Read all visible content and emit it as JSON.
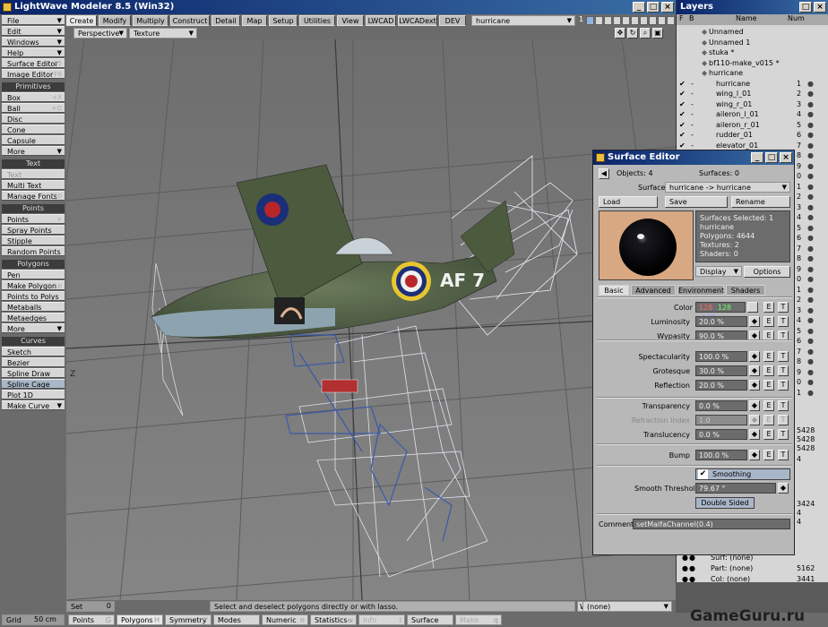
{
  "app": {
    "title": "LightWave Modeler 8.5 (Win32)",
    "min": "_",
    "max": "□",
    "close": "×"
  },
  "left_panel": {
    "top_items": [
      {
        "label": "File",
        "arrow": "▼"
      },
      {
        "label": "Edit",
        "arrow": "▼"
      },
      {
        "label": "Windows",
        "arrow": "▼"
      },
      {
        "label": "Help",
        "arrow": "▼"
      },
      {
        "label": "Surface Editor",
        "shortcut": "F5"
      },
      {
        "label": "Image Editor",
        "shortcut": "F6"
      }
    ],
    "groups": [
      {
        "header": "Primitives",
        "items": [
          {
            "label": "Box",
            "shortcut": "+X"
          },
          {
            "label": "Ball",
            "shortcut": "+O"
          },
          {
            "label": "Disc"
          },
          {
            "label": "Cone"
          },
          {
            "label": "Capsule"
          },
          {
            "label": "More",
            "arrow": "▼"
          }
        ]
      },
      {
        "header": "Text",
        "items": [
          {
            "label": "Text",
            "disabled": true
          },
          {
            "label": "Multi Text"
          },
          {
            "label": "Manage Fonts",
            "shortcut": "F10"
          }
        ]
      },
      {
        "header": "Points",
        "items": [
          {
            "label": "Points",
            "shortcut": "+"
          },
          {
            "label": "Spray Points"
          },
          {
            "label": "Stipple"
          },
          {
            "label": "Random Points"
          }
        ]
      },
      {
        "header": "Polygons",
        "items": [
          {
            "label": "Pen"
          },
          {
            "label": "Make Polygon",
            "shortcut": "p"
          },
          {
            "label": "Points to Polys"
          },
          {
            "label": "Metaballs"
          },
          {
            "label": "Metaedges"
          },
          {
            "label": "More",
            "arrow": "▼"
          }
        ]
      },
      {
        "header": "Curves",
        "items": [
          {
            "label": "Sketch"
          },
          {
            "label": "Bezier"
          },
          {
            "label": "Spline Draw"
          },
          {
            "label": "Spline Cage",
            "selected": true
          },
          {
            "label": "Plot 1D"
          },
          {
            "label": "Make Curve",
            "arrow": "▼"
          }
        ]
      }
    ]
  },
  "tabs": [
    "Create",
    "Modify",
    "Multiply",
    "Construct",
    "Detail",
    "Map",
    "Setup",
    "Utilities",
    "View",
    "LWCAD",
    "LWCADext",
    "DEV"
  ],
  "active_tab": "Create",
  "layer_dropdown": "hurricane",
  "layer_num": "1",
  "viewport": {
    "view_mode": "Perspective",
    "render_mode": "Texture",
    "plane_code": "AF 7",
    "axis_z": "Z",
    "nav_icons": [
      "move-icon",
      "rotate-icon",
      "zoom-icon",
      "maximize-icon"
    ]
  },
  "status": {
    "set_label": "Set",
    "set_value": "0",
    "message": "Select and deselect polygons directly or with lasso.",
    "wmcs": [
      "W",
      "T",
      "M",
      "C",
      "S"
    ],
    "none_dropdown": "(none)"
  },
  "bottom": {
    "grid_label": "Grid",
    "grid_value": "50 cm",
    "modes": [
      "Points",
      "Polygons",
      "Symmetry",
      "Modes",
      "Numeric",
      "Statistics",
      "Info",
      "Surface",
      "Make"
    ],
    "mode_shortcuts": [
      "G",
      "H",
      "Y",
      "",
      "n",
      "w",
      "i",
      "",
      "q"
    ],
    "watermark": "GameGuru.ru"
  },
  "layers": {
    "title": "Layers",
    "col_f": "F",
    "col_b": "B",
    "col_name": "Name",
    "col_num": "Num",
    "objects": [
      "Unnamed",
      "Unnamed 1",
      "stuka *",
      "bf110-make_v015 *",
      "hurricane"
    ],
    "items": [
      {
        "name": "hurricane",
        "num": "1"
      },
      {
        "name": "wing_l_01",
        "num": "2"
      },
      {
        "name": "wing_r_01",
        "num": "3"
      },
      {
        "name": "aileron_l_01",
        "num": "4"
      },
      {
        "name": "aileron_r_01",
        "num": "5"
      },
      {
        "name": "rudder_01",
        "num": "6"
      },
      {
        "name": "elevator_01",
        "num": "7"
      }
    ],
    "extra_nums": [
      "8",
      "9",
      "0",
      "1",
      "2",
      "3",
      "4",
      "5",
      "6",
      "7",
      "8",
      "9",
      "0",
      "1",
      "2",
      "3",
      "4",
      "5",
      "6",
      "7",
      "8",
      "9",
      "0",
      "1"
    ]
  },
  "stats_panel": {
    "numbers": [
      "5428",
      "5428",
      "5428",
      "4",
      "3424",
      "4",
      "4"
    ],
    "rows": [
      {
        "label": "Surf: (none)",
        "value": ""
      },
      {
        "label": "Part: (none)",
        "value": "5162"
      },
      {
        "label": "Col: (none)",
        "value": "3441"
      }
    ]
  },
  "surface_editor": {
    "title": "Surface Editor",
    "objects": "Objects: 4",
    "surfaces": "Surfaces: 0",
    "surface_label": "Surface",
    "surface_value": "hurricane -> hurricane",
    "load": "Load",
    "save": "Save",
    "rename": "Rename",
    "info": [
      "Surfaces Selected: 1",
      "hurricane",
      "Polygons: 4644",
      "Textures: 2",
      "Shaders: 0"
    ],
    "display": "Display",
    "options": "Options",
    "tabs": [
      "Basic",
      "Advanced",
      "Environment",
      "Shaders"
    ],
    "active_tab": "Basic",
    "color_label": "Color",
    "color_values": [
      "128",
      "128",
      "128"
    ],
    "params": [
      {
        "label": "Luminosity",
        "value": "20.0 %"
      },
      {
        "label": "Wypasity",
        "value": "90.0 %"
      },
      {
        "label": "Spectacularity",
        "value": "100.0 %"
      },
      {
        "label": "Grotesque",
        "value": "30.0 %"
      },
      {
        "label": "Reflection",
        "value": "20.0 %"
      },
      {
        "label": "Transparency",
        "value": "0.0 %"
      },
      {
        "label": "Refraction Index",
        "value": "1.0",
        "disabled": true
      },
      {
        "label": "Translucency",
        "value": "0.0 %"
      },
      {
        "label": "Bump",
        "value": "100.0 %"
      }
    ],
    "smoothing": "Smoothing",
    "smooth_threshold_label": "Smooth Threshold",
    "smooth_threshold": "79.67 °",
    "double_sided": "Double Sided",
    "comment_label": "Comment",
    "comment": "setMalfaChannel(0.4)",
    "e_label": "E",
    "t_label": "T"
  }
}
